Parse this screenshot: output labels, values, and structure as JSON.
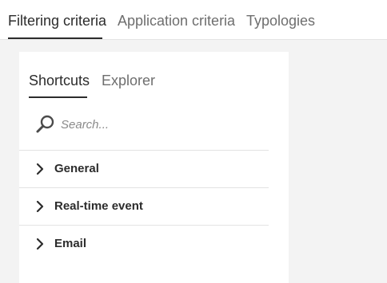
{
  "top_tabs": [
    {
      "label": "Filtering criteria"
    },
    {
      "label": "Application criteria"
    },
    {
      "label": "Typologies"
    }
  ],
  "panel": {
    "tabs": [
      {
        "label": "Shortcuts"
      },
      {
        "label": "Explorer"
      }
    ],
    "search": {
      "placeholder": "Search...",
      "value": ""
    },
    "items": [
      {
        "label": "General"
      },
      {
        "label": "Real-time event"
      },
      {
        "label": "Email"
      }
    ]
  },
  "icons": {
    "search": "search-icon",
    "expand": "chevron-right-icon"
  }
}
